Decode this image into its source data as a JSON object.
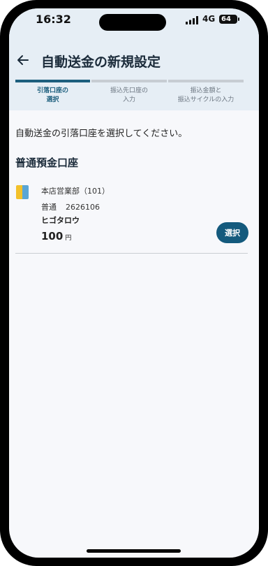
{
  "status_bar": {
    "time": "16:32",
    "network": "4G",
    "battery": "64",
    "icons": [
      "signal-icon",
      "battery-icon"
    ]
  },
  "header": {
    "back_icon": "arrow-left-icon",
    "title": "自動送金の新規設定"
  },
  "steps": [
    {
      "label": "引落口座の\n選択",
      "active": true
    },
    {
      "label": "振込先口座の\n入力",
      "active": false
    },
    {
      "label": "振込金額と\n振込サイクルの入力",
      "active": false
    }
  ],
  "main": {
    "instruction": "自動送金の引落口座を選択してください。",
    "section_heading": "普通預金口座",
    "account": {
      "icon": "bank-card-icon",
      "branch": "本店営業部（101）",
      "type": "普通",
      "number": "2626106",
      "holder": "ヒゴタロウ",
      "balance": "100",
      "currency_unit": "円",
      "select_label": "選択"
    }
  },
  "colors": {
    "accent": "#145a7d",
    "header_bg": "#e6eef5",
    "page_bg": "#f7f8fb",
    "step_inactive": "#c7cdd3",
    "card_icon_yellow": "#f3c12b",
    "card_icon_blue": "#5aa6d6"
  }
}
